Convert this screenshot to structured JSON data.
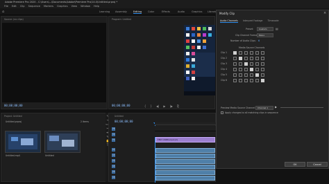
{
  "app": {
    "title": "Adobe Premiere Pro 2020 - C:\\Users\\...\\Documents\\Adobe\\Premiere Pro\\14.0\\Untitled.prproj *"
  },
  "menu": [
    "File",
    "Edit",
    "Clip",
    "Sequence",
    "Markers",
    "Graphics",
    "View",
    "Window",
    "Help"
  ],
  "workspaces": [
    {
      "label": "Learning"
    },
    {
      "label": "Assembly"
    },
    {
      "label": "Editing",
      "active": true
    },
    {
      "label": "Color"
    },
    {
      "label": "Effects"
    },
    {
      "label": "Audio"
    },
    {
      "label": "Graphics"
    },
    {
      "label": "Libraries"
    }
  ],
  "source_monitor": {
    "tab": "Source: (no clips)",
    "timecode": "00;00;00;00",
    "timecode_right": "00;00;00;00"
  },
  "program_monitor": {
    "tab": "Program: Untitled",
    "timecode": "00;00;00;00",
    "timecode_right": "00;00;00;00"
  },
  "project_panel": {
    "tab": "Project: Untitled",
    "path": "Untitled.prproj",
    "item_count": "2 Items",
    "items": [
      {
        "label": "Untitled.mp4"
      },
      {
        "label": "Untitled"
      }
    ]
  },
  "timeline": {
    "tab": "Untitled",
    "timecode": "00;00;00;00",
    "video_tracks": [
      "V3",
      "V2",
      "V1"
    ],
    "audio_tracks": [
      "A1",
      "A2",
      "A3",
      "A4",
      "A5",
      "A6"
    ],
    "clip_label": "TEST VIDEO.mp4 [V]"
  },
  "dialog": {
    "title": "Modify Clip",
    "tabs": [
      {
        "label": "Audio Channels",
        "active": true
      },
      {
        "label": "Interpret Footage"
      },
      {
        "label": "Timecode"
      }
    ],
    "preset_label": "Preset:",
    "preset_value": "Custom",
    "format_label": "Clip Channel Format:",
    "format_value": "Mono",
    "num_clips_label": "Number of Audio Clips:",
    "num_clips_value": "6",
    "source_channels_label": "Media Source Channels",
    "rows": [
      {
        "label": "Clip 1",
        "checks": [
          true,
          false,
          false,
          false,
          false,
          false
        ]
      },
      {
        "label": "Clip 2",
        "checks": [
          false,
          true,
          false,
          false,
          false,
          false
        ]
      },
      {
        "label": "Clip 3",
        "checks": [
          false,
          false,
          true,
          false,
          false,
          false
        ]
      },
      {
        "label": "Clip 4",
        "checks": [
          false,
          false,
          false,
          true,
          false,
          false
        ]
      },
      {
        "label": "Clip 5",
        "checks": [
          false,
          false,
          false,
          false,
          true,
          false
        ]
      },
      {
        "label": "Clip 6",
        "checks": [
          false,
          false,
          false,
          false,
          false,
          true
        ]
      }
    ],
    "preview_label": "Preview Media Source Channel:",
    "preview_value": "Channel 1",
    "apply_label": "Apply changes to all matching clips in sequence",
    "ok": "OK",
    "cancel": "Cancel"
  }
}
